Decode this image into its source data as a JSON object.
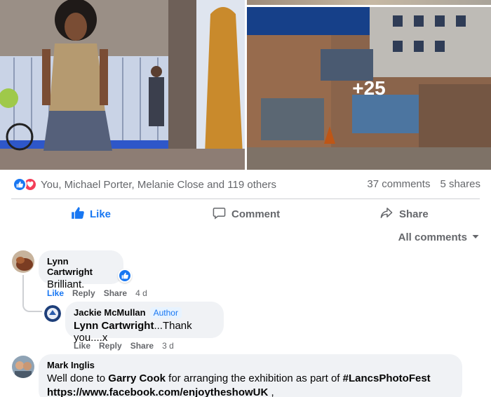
{
  "photos": {
    "more_count": "+25"
  },
  "reactions": {
    "summary": "You, Michael Porter, Melanie Close and 119 others",
    "comments_count": "37 comments",
    "shares_count": "5 shares"
  },
  "actions": {
    "like": "Like",
    "comment": "Comment",
    "share": "Share"
  },
  "filter": {
    "label": "All comments"
  },
  "comments": [
    {
      "author": "Lynn Cartwright",
      "text": "Brilliant.",
      "like": "Like",
      "reply": "Reply",
      "share": "Share",
      "time": "4 d"
    },
    {
      "author": "Jackie McMullan",
      "badge": "Author",
      "mention": "Lynn Cartwright",
      "text": "...Thank you....x",
      "like": "Like",
      "reply": "Reply",
      "share": "Share",
      "time": "3 d"
    },
    {
      "author": "Mark Inglis",
      "text_prefix": "Well done to ",
      "mention": "Garry Cook",
      "text_middle": " for arranging the exhibition as part of ",
      "hashtag": "#LancsPhotoFest",
      "url": "https://www.facebook.com/enjoytheshowUK",
      "url_suffix": " ,"
    }
  ],
  "colors": {
    "accent": "#1877f2",
    "love": "#f33e58",
    "secondary_text": "#65676b",
    "bubble": "#f0f2f5"
  }
}
